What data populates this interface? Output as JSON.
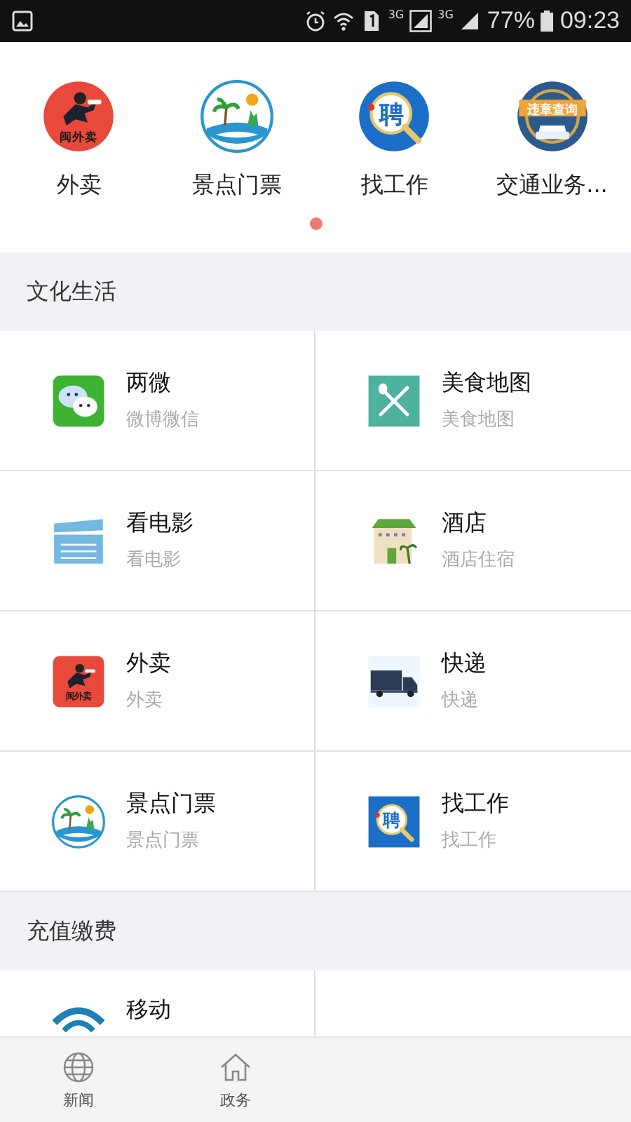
{
  "status_bar": {
    "sim_labels": [
      "3G",
      "3G"
    ],
    "battery": "77%",
    "time": "09:23"
  },
  "quick_apps": [
    {
      "label": "外卖",
      "kind": "takeout",
      "icon_text": "闽外卖"
    },
    {
      "label": "景点门票",
      "kind": "scenic"
    },
    {
      "label": "找工作",
      "kind": "job",
      "icon_text": "聘"
    },
    {
      "label": "交通业务...",
      "kind": "traffic",
      "icon_text": "违章查询"
    }
  ],
  "pager": [
    {
      "selected": true
    }
  ],
  "sections": [
    {
      "title": "文化生活",
      "items": [
        {
          "title": "两微",
          "subtitle": "微博微信",
          "kind": "wechat"
        },
        {
          "title": "美食地图",
          "subtitle": "美食地图",
          "kind": "food"
        },
        {
          "title": "看电影",
          "subtitle": "看电影",
          "kind": "movie"
        },
        {
          "title": "酒店",
          "subtitle": "酒店住宿",
          "kind": "hotel"
        },
        {
          "title": "外卖",
          "subtitle": "外卖",
          "kind": "takeout",
          "icon_text": "闽外卖"
        },
        {
          "title": "快递",
          "subtitle": "快递",
          "kind": "delivery"
        },
        {
          "title": "景点门票",
          "subtitle": "景点门票",
          "kind": "scenic"
        },
        {
          "title": "找工作",
          "subtitle": "找工作",
          "kind": "job",
          "icon_text": "聘"
        }
      ]
    },
    {
      "title": "充值缴费",
      "items": [
        {
          "title": "移动",
          "kind": "mobile"
        }
      ]
    }
  ],
  "tab_bar": [
    {
      "label": "新闻",
      "kind": "news"
    },
    {
      "label": "政务",
      "kind": "gov"
    }
  ]
}
